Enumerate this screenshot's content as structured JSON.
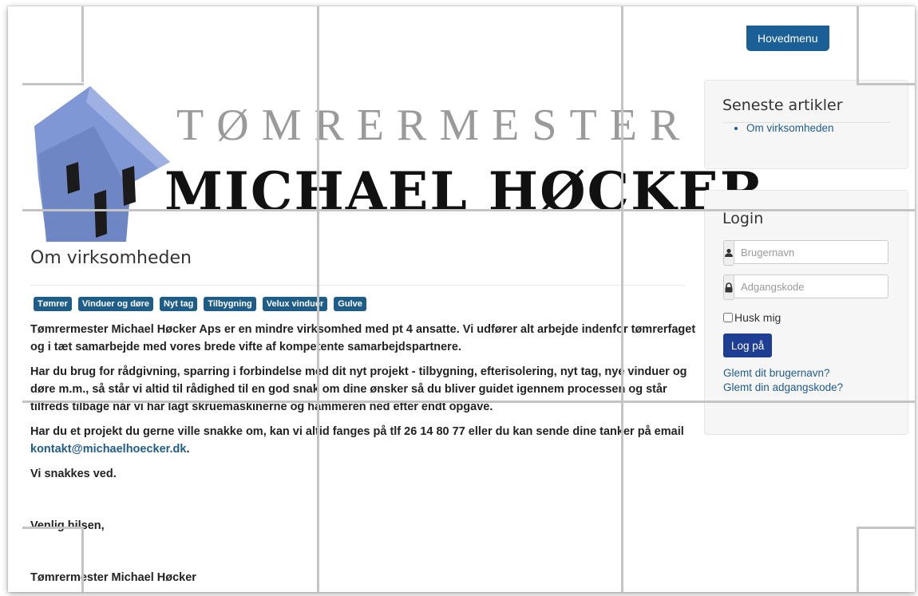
{
  "header": {
    "menu_button": "Hovedmenu",
    "logo": {
      "line1": "TØMRERMESTER",
      "line2": "MICHAEL HØCKER",
      "house_color": "#7f97d4"
    }
  },
  "main": {
    "title": "Om virksomheden",
    "tags": [
      "Tømrer",
      "Vinduer og døre",
      "Nyt tag",
      "Tilbygning",
      "Velux vinduer",
      "Gulve"
    ],
    "paragraphs": {
      "p1": "Tømrermester Michael Høcker Aps er en mindre virksomhed med pt 4 ansatte. Vi udfører alt arbejde indenfor tømrerfaget og i tæt samarbejde med vores brede vifte af kompetente samarbejdspartnere.",
      "p2": "Har du brug for rådgivning, sparring i forbindelse med dit nyt projekt - tilbygning, efterisolering, nyt tag, nye vinduer og døre m.m., så står vi altid til rådighed til en god snak om dine ønsker så du bliver guidet igennem processen og står tilfreds tilbage når vi har lagt skruemaskinerne og hammeren ned efter endt opgave.",
      "p3_pre": "Har du et projekt du gerne ville snakke om, kan vi altid fanges på tlf 26 14 80 77 eller du kan sende dine tanker på email ",
      "p3_link": "kontakt@michaelhoecker.dk",
      "p3_post": ".",
      "p4": "Vi snakkes ved.",
      "p5": "Venlig hilsen,",
      "p6": "Tømrermester Michael Høcker"
    }
  },
  "sidebar": {
    "latest": {
      "title": "Seneste artikler",
      "items": [
        "Om virksomheden"
      ]
    },
    "login": {
      "title": "Login",
      "username_placeholder": "Brugernavn",
      "password_placeholder": "Adgangskode",
      "remember_label": "Husk mig",
      "submit_label": "Log på",
      "forgot_username": "Glemt dit brugernavn?",
      "forgot_password": "Glemt din adgangskode?"
    }
  },
  "colors": {
    "accent": "#1f5d89",
    "login_button": "#1e3e93",
    "menu_button": "#1a5f96"
  }
}
